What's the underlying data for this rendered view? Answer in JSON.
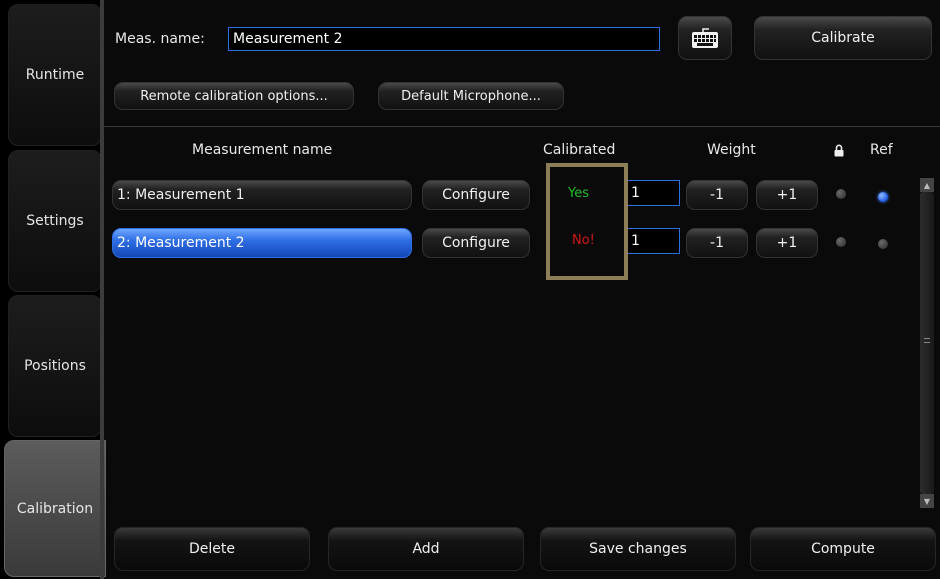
{
  "sidebar": {
    "tabs": [
      {
        "label": "Runtime"
      },
      {
        "label": "Settings"
      },
      {
        "label": "Positions"
      },
      {
        "label": "Calibration"
      }
    ]
  },
  "header": {
    "meas_name_label": "Meas. name:",
    "meas_name_value": "Measurement 2",
    "calibrate_label": "Calibrate",
    "remote_options_label": "Remote calibration options...",
    "default_mic_label": "Default Microphone..."
  },
  "table": {
    "columns": {
      "name": "Measurement name",
      "calibrated": "Calibrated",
      "weight": "Weight",
      "ref": "Ref"
    },
    "rows": [
      {
        "name": "1: Measurement 1",
        "configure": "Configure",
        "calibrated": "Yes",
        "weight": "1",
        "minus": "-1",
        "plus": "+1",
        "ref": true
      },
      {
        "name": "2: Measurement 2",
        "configure": "Configure",
        "calibrated": "No!",
        "weight": "1",
        "minus": "-1",
        "plus": "+1",
        "ref": false
      }
    ]
  },
  "footer": {
    "delete_label": "Delete",
    "add_label": "Add",
    "save_label": "Save changes",
    "compute_label": "Compute"
  },
  "colors": {
    "calibrated_yes": "#1fbf2a",
    "calibrated_no": "#d01818",
    "accent": "#2f6fe6",
    "highlight_box": "#8c7f58"
  },
  "icons": {
    "keyboard": "keyboard-icon",
    "lock": "lock-icon"
  }
}
